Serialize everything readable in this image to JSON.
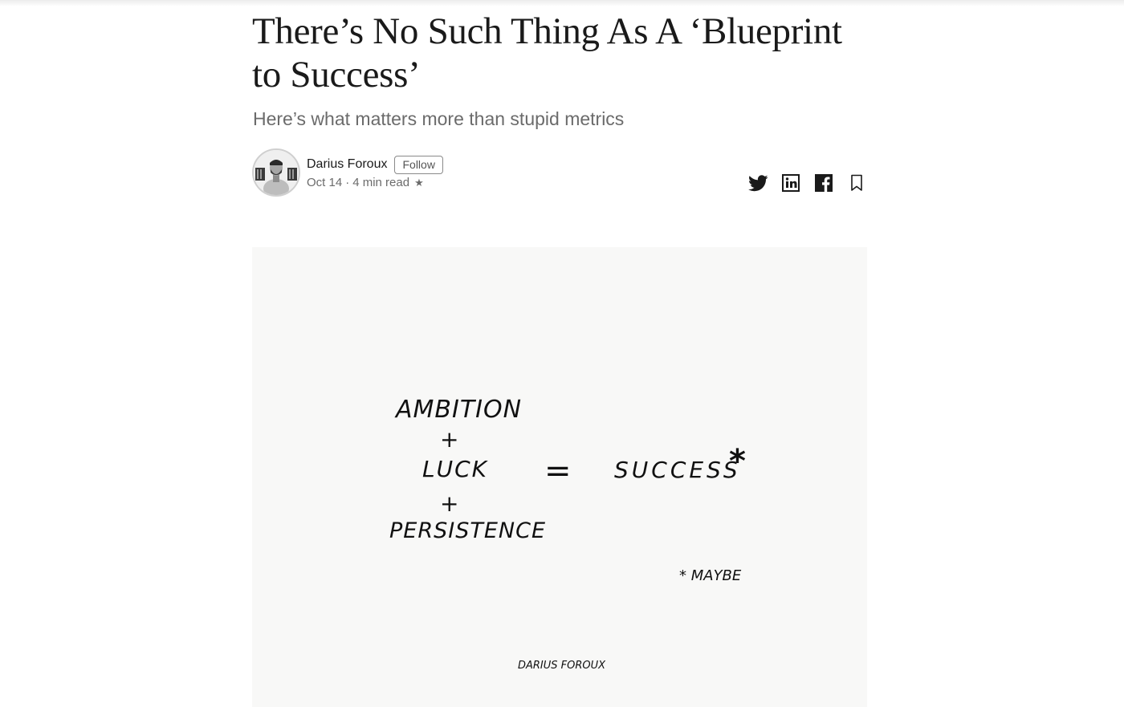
{
  "article": {
    "title": "There’s No Such Thing As A ‘Blueprint to Success’",
    "subtitle": "Here’s what matters more than stupid metrics"
  },
  "byline": {
    "author": "Darius Foroux",
    "follow_label": "Follow",
    "date": "Oct 14",
    "separator": "·",
    "read_time": "4 min read",
    "member_icon": "star-icon"
  },
  "share": {
    "icons": [
      "twitter-icon",
      "linkedin-icon",
      "facebook-icon",
      "bookmark-icon"
    ]
  },
  "hero_image": {
    "line1": "AMBITION",
    "plus1": "+",
    "line2": "LUCK",
    "plus2": "+",
    "line3": "PERSISTENCE",
    "equals": "=",
    "result": "SUCCESS",
    "asterisk": "*",
    "footnote": "* MAYBE",
    "signature": "DARIUS FOROUX"
  }
}
